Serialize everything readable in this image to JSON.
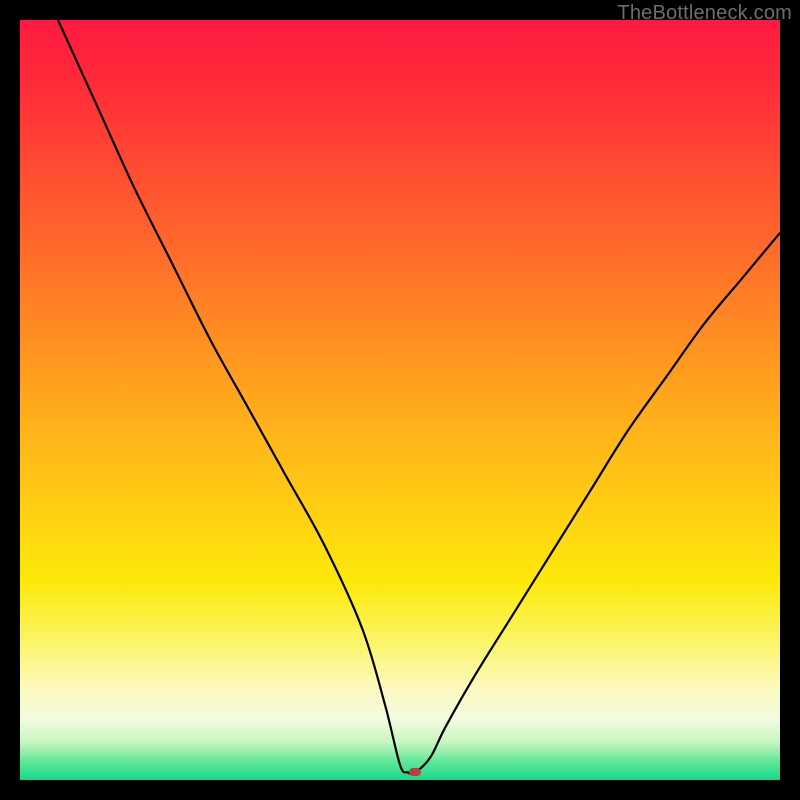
{
  "watermark": "TheBottleneck.com",
  "colors": {
    "curve_stroke": "#000000",
    "marker_fill": "#b7403e"
  },
  "chart_data": {
    "type": "line",
    "title": "",
    "xlabel": "",
    "ylabel": "",
    "xlim": [
      0,
      100
    ],
    "ylim": [
      0,
      100
    ],
    "grid": false,
    "legend": false,
    "annotations": [
      {
        "name": "marker",
        "x": 52,
        "y": 1
      }
    ],
    "series": [
      {
        "name": "bottleneck-curve",
        "x": [
          5,
          10,
          15,
          20,
          25,
          30,
          35,
          40,
          45,
          48,
          50,
          51,
          52,
          54,
          56,
          60,
          65,
          70,
          75,
          80,
          85,
          90,
          95,
          100
        ],
        "y": [
          100,
          89,
          78,
          68,
          58,
          49,
          40,
          31,
          20,
          10,
          2,
          1,
          1,
          3,
          7,
          14,
          22,
          30,
          38,
          46,
          53,
          60,
          66,
          72
        ]
      }
    ]
  }
}
